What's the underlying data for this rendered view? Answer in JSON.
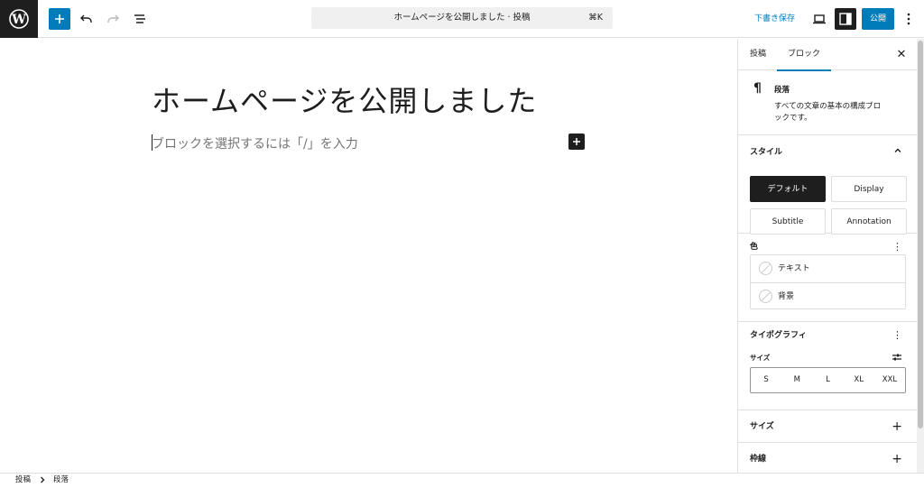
{
  "toolbar": {
    "command_title": "ホームページを公開しました · 投稿",
    "command_shortcut": "⌘K",
    "save_draft": "下書き保存",
    "publish": "公開"
  },
  "editor": {
    "post_title": "ホームページを公開しました",
    "placeholder": "ブロックを選択するには「/」を入力"
  },
  "sidebar": {
    "tabs": [
      "投稿",
      "ブロック"
    ],
    "active_tab": "ブロック",
    "block": {
      "name": "段落",
      "description": "すべての文章の基本の構成ブロックです。"
    },
    "styles": {
      "title": "スタイル",
      "options": [
        "デフォルト",
        "Display",
        "Subtitle",
        "Annotation"
      ],
      "selected": "デフォルト"
    },
    "color": {
      "title": "色",
      "items": [
        "テキスト",
        "背景"
      ]
    },
    "typography": {
      "title": "タイポグラフィ",
      "size_label": "サイズ",
      "sizes": [
        "S",
        "M",
        "L",
        "XL",
        "XXL"
      ]
    },
    "collapsed_panels": [
      "サイズ",
      "枠線"
    ]
  },
  "footer": {
    "breadcrumb": [
      "投稿",
      "段落"
    ]
  },
  "colors": {
    "accent": "#007cba",
    "dark": "#1e1e1e",
    "border": "#e0e0e0"
  }
}
